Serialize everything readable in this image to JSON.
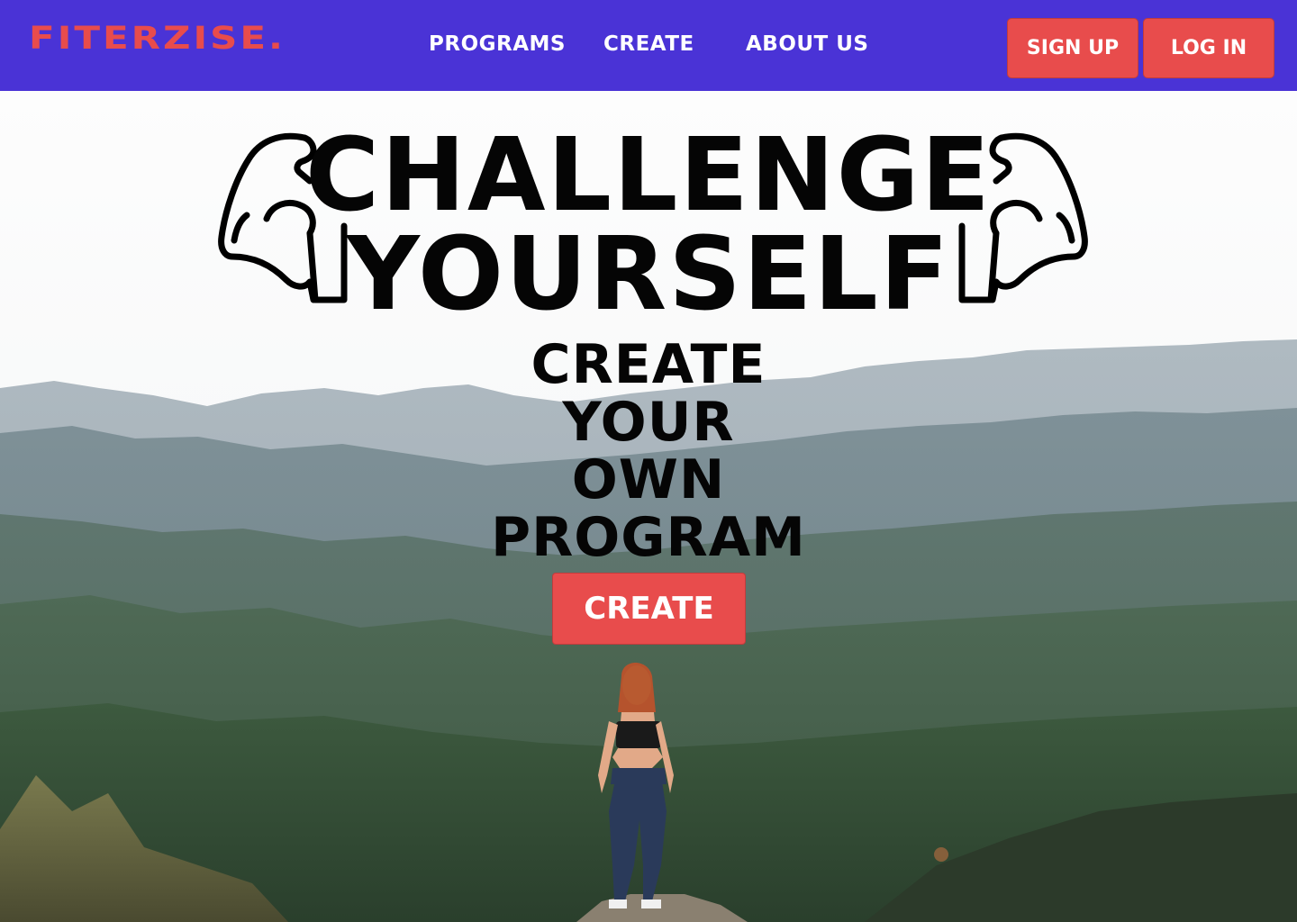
{
  "brand": {
    "logo_text": "FITERZISE.",
    "accent_color": "#e84c4c",
    "nav_color": "#4a33d6"
  },
  "nav": {
    "links": [
      {
        "label": "PROGRAMS"
      },
      {
        "label": "CREATE"
      },
      {
        "label": "ABOUT US"
      }
    ],
    "sign_up_label": "SIGN UP",
    "log_in_label": "LOG IN"
  },
  "hero": {
    "headline_line1": "CHALLENGE",
    "headline_line2": "YOURSELF",
    "sub_lines": [
      "CREATE",
      "YOUR",
      "OWN",
      "PROGRAM"
    ],
    "cta_label": "CREATE",
    "left_icon": "flexed-bicep-icon",
    "right_icon": "flexed-bicep-icon",
    "background": "mountain-landscape-photo"
  }
}
